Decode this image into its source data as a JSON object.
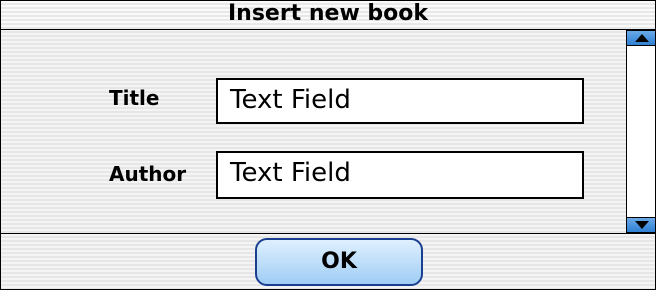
{
  "window": {
    "title": "Insert new book"
  },
  "form": {
    "title_label": "Title",
    "title_value": "Text Field",
    "author_label": "Author",
    "author_value": "Text Field"
  },
  "actions": {
    "ok_label": "OK"
  },
  "icons": {
    "scroll_up": "triangle-up-icon",
    "scroll_down": "triangle-down-icon"
  },
  "colors": {
    "button_border": "#1a3f8f",
    "button_fill_top": "#dff0ff",
    "button_fill_bottom": "#9fcdf5",
    "scroll_arrow": "#2f7fd3"
  }
}
